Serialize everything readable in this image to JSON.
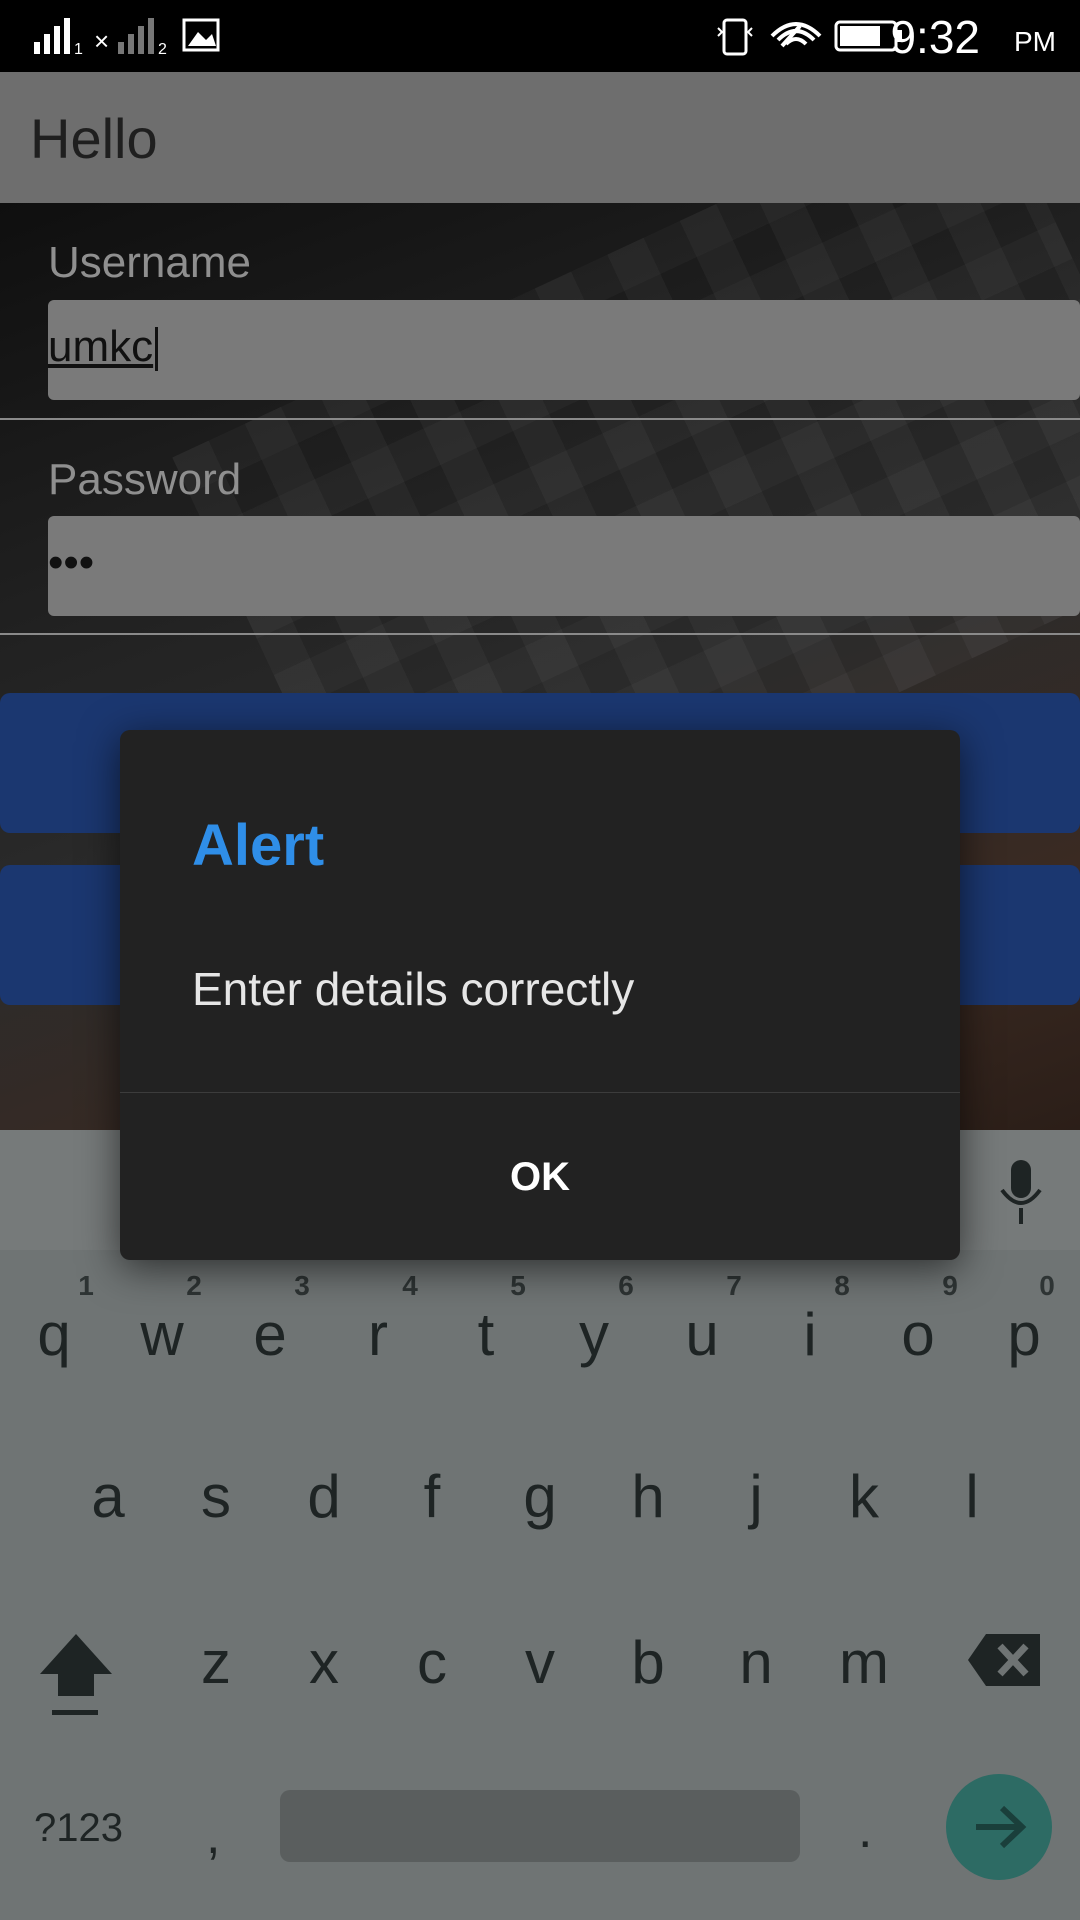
{
  "status_bar": {
    "signal1_sub": "1",
    "signal2_sub": "2",
    "time": "9:32",
    "ampm": "PM"
  },
  "app": {
    "title": "Hello",
    "username_label": "Username",
    "username_value": "umkc",
    "password_label": "Password",
    "password_value": "•••"
  },
  "dialog": {
    "title": "Alert",
    "message": "Enter details correctly",
    "ok_label": "OK"
  },
  "keyboard": {
    "row1": [
      "q",
      "w",
      "e",
      "r",
      "t",
      "y",
      "u",
      "i",
      "o",
      "p"
    ],
    "row1_hints": [
      "1",
      "2",
      "3",
      "4",
      "5",
      "6",
      "7",
      "8",
      "9",
      "0"
    ],
    "row2": [
      "a",
      "s",
      "d",
      "f",
      "g",
      "h",
      "j",
      "k",
      "l"
    ],
    "row3": [
      "z",
      "x",
      "c",
      "v",
      "b",
      "n",
      "m"
    ],
    "symbols_label": "?123",
    "comma": ",",
    "period": "."
  }
}
